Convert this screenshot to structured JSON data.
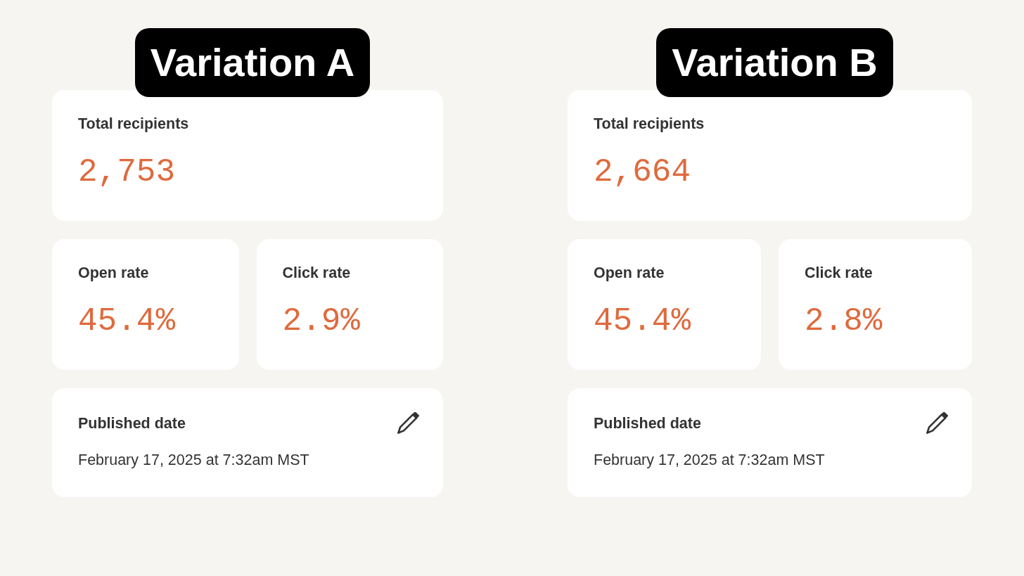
{
  "variations": [
    {
      "title": "Variation A",
      "total": {
        "label": "Total recipients",
        "value": "2,753"
      },
      "rates": [
        {
          "label": "Open rate",
          "value": "45.4%"
        },
        {
          "label": "Click rate",
          "value": "2.9%"
        }
      ],
      "published": {
        "label": "Published date",
        "value": "February 17, 2025 at 7:32am MST"
      }
    },
    {
      "title": "Variation B",
      "total": {
        "label": "Total recipients",
        "value": "2,664"
      },
      "rates": [
        {
          "label": "Open rate",
          "value": "45.4%"
        },
        {
          "label": "Click rate",
          "value": "2.8%"
        }
      ],
      "published": {
        "label": "Published date",
        "value": "February 17, 2025 at 7:32am MST"
      }
    }
  ]
}
